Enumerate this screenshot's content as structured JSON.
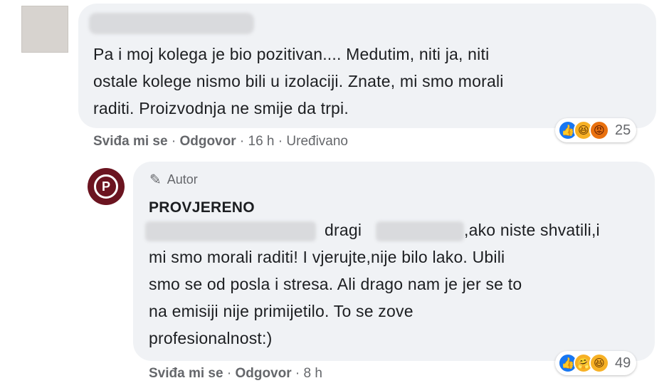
{
  "comment1": {
    "lines": [
      "Pa i moj kolega je bio pozitivan.... Medutim, niti ja, niti",
      "ostale kolege nismo bili u izolaciji. Znate, mi smo morali",
      "raditi. Proizvodnja ne smije da trpi."
    ],
    "reactions": {
      "icons": [
        "like-icon",
        "haha-icon",
        "angry-icon"
      ],
      "count": "25"
    },
    "like_label": "Sviđa mi se",
    "sep": "·",
    "reply_label": "Odgovor",
    "time": "16 h",
    "edited": "Uređivano"
  },
  "comment2": {
    "author_badge": "Autor",
    "author_name": "PROVJERENO",
    "avatar_letter": "P",
    "line1_part1": "dragi",
    "line1_part2": ",ako niste shvatili,i",
    "lines": [
      "mi smo morali raditi! I vjerujte,nije bilo lako. Ubili",
      "smo se od posla i stresa. Ali drago nam je jer se to",
      "na emisiji nije primijetilo. To se zove",
      "profesionalnost:)"
    ],
    "reactions": {
      "icons": [
        "like-icon",
        "care-icon",
        "haha-icon"
      ],
      "count": "49"
    },
    "like_label": "Sviđa mi se",
    "sep": "·",
    "reply_label": "Odgovor",
    "time": "8 h"
  },
  "colors": {
    "bubble": "#f0f2f5",
    "meta": "#65676b",
    "like": "#1877f2",
    "avatar": "#6b1420"
  }
}
